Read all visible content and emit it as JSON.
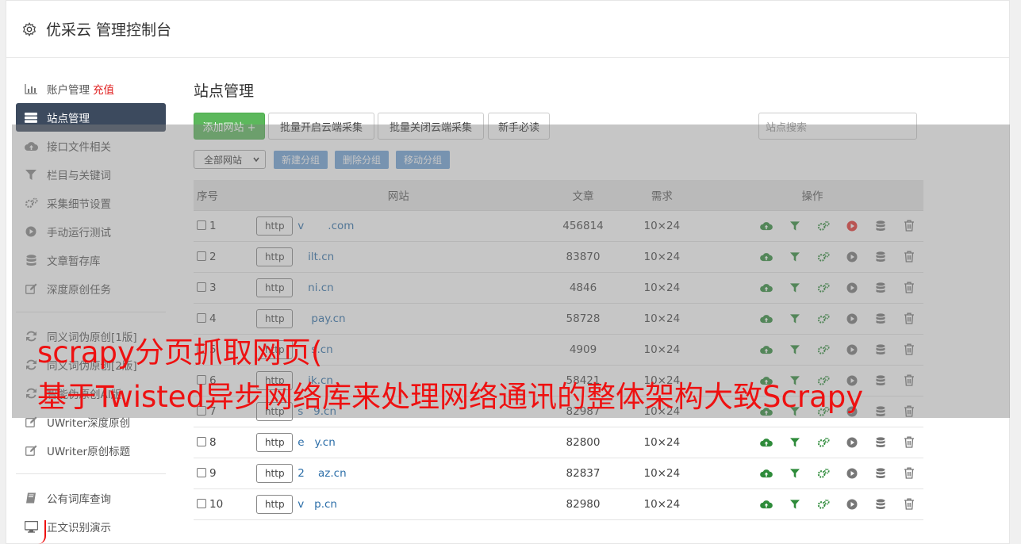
{
  "app": {
    "title": "优采云 管理控制台"
  },
  "sidebar": {
    "group1": [
      {
        "label": "账户管理",
        "badge": "充值",
        "icon": "bar-chart-icon"
      },
      {
        "label": "站点管理",
        "icon": "server-icon",
        "active": true
      },
      {
        "label": "接口文件相关",
        "icon": "cloud-upload-icon"
      },
      {
        "label": "栏目与关键词",
        "icon": "filter-icon"
      },
      {
        "label": "采集细节设置",
        "icon": "gears-icon"
      },
      {
        "label": "手动运行测试",
        "icon": "play-circle-icon"
      },
      {
        "label": "文章暂存库",
        "icon": "database-icon"
      },
      {
        "label": "深度原创任务",
        "icon": "edit-icon"
      }
    ],
    "group2": [
      {
        "label": "同义词伪原创[1版]",
        "icon": "refresh-icon"
      },
      {
        "label": "同义词伪原创[2版]",
        "icon": "refresh-icon"
      },
      {
        "label": "智能伪原创AI版",
        "icon": "refresh-icon"
      },
      {
        "label": "UWriter深度原创",
        "icon": "edit-icon"
      },
      {
        "label": "UWriter原创标题",
        "icon": "edit-icon"
      }
    ],
    "group3": [
      {
        "label": "公有词库查询",
        "icon": "book-icon"
      },
      {
        "label": "正文识别演示",
        "icon": "monitor-icon"
      }
    ]
  },
  "main": {
    "title": "站点管理",
    "toolbar": {
      "add_site": "添加网站 +",
      "batch_on": "批量开启云端采集",
      "batch_off": "批量关闭云端采集",
      "newbie": "新手必读",
      "search_placeholder": "站点搜索"
    },
    "filters": {
      "group_select": "全部网站",
      "new_group": "新建分组",
      "delete_group": "删除分组",
      "move_group": "移动分组"
    },
    "table": {
      "headers": {
        "no": "序号",
        "site": "网站",
        "articles": "文章",
        "demand": "需求",
        "ops": "操作"
      },
      "rows": [
        {
          "no": "1",
          "proto": "http",
          "domain": "v       .com",
          "articles": "456814",
          "demand": "10×24",
          "running": true
        },
        {
          "no": "2",
          "proto": "http",
          "domain": "   ilt.cn",
          "articles": "83870",
          "demand": "10×24"
        },
        {
          "no": "3",
          "proto": "http",
          "domain": "   ni.cn",
          "articles": "4846",
          "demand": "10×24"
        },
        {
          "no": "4",
          "proto": "http",
          "domain": "    pay.cn",
          "articles": "58728",
          "demand": "10×24"
        },
        {
          "no": "5",
          "proto": "http",
          "domain": "    s.cn",
          "articles": "4909",
          "demand": "10×24"
        },
        {
          "no": "6",
          "proto": "http",
          "domain": "   ik.cn",
          "articles": "58421",
          "demand": "10×24"
        },
        {
          "no": "7",
          "proto": "http",
          "domain": "s   9.cn",
          "articles": "82987",
          "demand": "10×24"
        },
        {
          "no": "8",
          "proto": "http",
          "domain": "e   y.cn",
          "articles": "82800",
          "demand": "10×24"
        },
        {
          "no": "9",
          "proto": "http",
          "domain": "2    az.cn",
          "articles": "82837",
          "demand": "10×24"
        },
        {
          "no": "10",
          "proto": "http",
          "domain": "v   p.cn",
          "articles": "82980",
          "demand": "10×24"
        }
      ]
    }
  },
  "overlay": {
    "line1": "scrapy分页抓取网页(",
    "line2": "基于Twisted异步网络库来处理网络通讯的整体架构大致Scrapy"
  },
  "colors": {
    "accent_green": "#5cb85c",
    "sidebar_active": "#3c4a5e",
    "link_blue": "#2c6ea8",
    "small_button_blue": "#6fa3d8",
    "caption_red": "#ee1111",
    "run_red": "#e8322f"
  }
}
